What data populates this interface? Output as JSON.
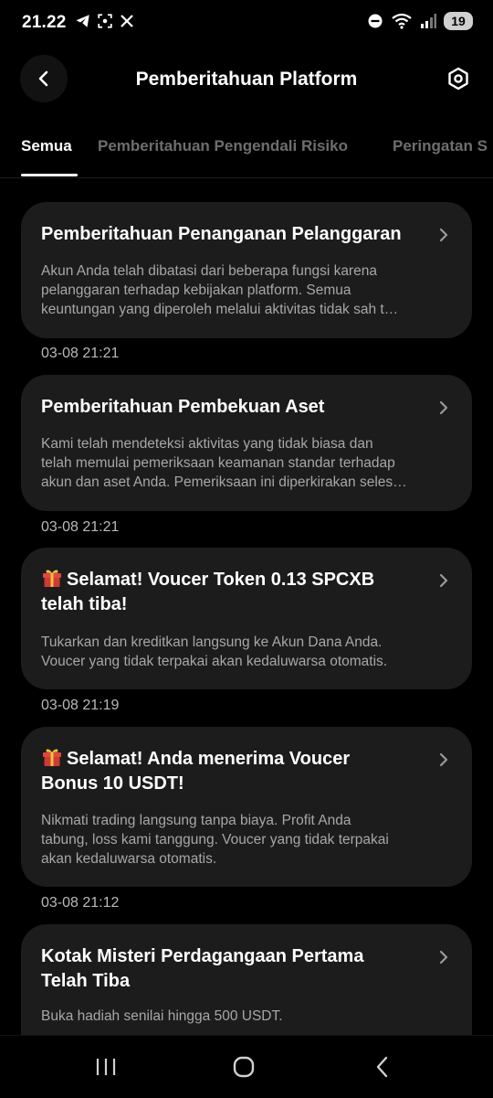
{
  "statusbar": {
    "time": "21.22",
    "battery": "19"
  },
  "header": {
    "title": "Pemberitahuan Platform"
  },
  "tabs": [
    {
      "label": "Semua"
    },
    {
      "label": "Pemberitahuan Pengendali Risiko"
    },
    {
      "label": "Peringatan S"
    }
  ],
  "notifications": [
    {
      "title": "Pemberitahuan Penanganan Pelanggaran",
      "body": [
        "Akun Anda telah dibatasi dari beberapa fungsi karena",
        "pelanggaran terhadap kebijakan platform. Semua",
        "keuntungan yang diperoleh melalui aktivitas tidak sah t…"
      ],
      "time": "03-08 21:21"
    },
    {
      "title": "Pemberitahuan Pembekuan Aset",
      "body": [
        "Kami telah mendeteksi aktivitas yang tidak biasa dan",
        "telah memulai pemeriksaan keamanan standar terhadap",
        "akun dan aset Anda. Pemeriksaan ini diperkirakan seles…"
      ],
      "time": "03-08 21:21"
    },
    {
      "title_lines": [
        "Selamat! Voucer Token 0.13 SPCXB",
        "telah tiba!"
      ],
      "body": [
        "Tukarkan dan kreditkan langsung ke Akun Dana Anda.",
        "Voucer yang tidak terpakai akan kedaluwarsa otomatis."
      ],
      "time": "03-08 21:19"
    },
    {
      "title_lines": [
        "Selamat! Anda menerima Voucer",
        "Bonus 10 USDT!"
      ],
      "body": [
        "Nikmati trading langsung tanpa biaya. Profit Anda",
        "tabung, loss kami tanggung. Voucer yang tidak terpakai",
        "akan kedaluwarsa otomatis."
      ],
      "time": "03-08 21:12"
    },
    {
      "title_lines": [
        "Kotak Misteri Perdagangaan Pertama",
        "Telah Tiba"
      ],
      "body": [
        "Buka hadiah senilai hingga 500 USDT."
      ]
    }
  ],
  "icons": {
    "back": "chevron-left-icon",
    "settings": "hexagon-gear-icon",
    "chevron": "chevron-right-icon",
    "gift": "gift-emoji-icon"
  },
  "colors": {
    "background": "#000000",
    "card": "#1c1c1c",
    "muted_text": "#a7a7a7"
  }
}
